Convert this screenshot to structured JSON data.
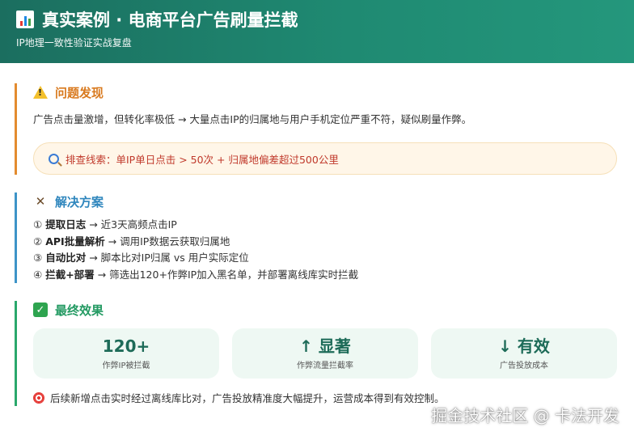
{
  "header": {
    "title": "真实案例 · 电商平台广告刷量拦截",
    "subtitle": "IP地理一致性验证实战复盘"
  },
  "problem": {
    "heading": "问题发现",
    "text": "广告点击量激增，但转化率极低 → 大量点击IP的归属地与用户手机定位严重不符，疑似刷量作弊。",
    "clue": "排查线索：单IP单日点击 > 50次 + 归属地偏差超过500公里"
  },
  "solution": {
    "heading": "解决方案",
    "steps": [
      {
        "num": "①",
        "bold": "提取日志",
        "text": " → 近3天高频点击IP"
      },
      {
        "num": "②",
        "bold": "API批量解析",
        "text": " → 调用IP数据云获取归属地"
      },
      {
        "num": "③",
        "bold": "自动比对",
        "text": " → 脚本比对IP归属 vs 用户实际定位"
      },
      {
        "num": "④",
        "bold": "拦截+部署",
        "text": " → 筛选出120+作弊IP加入黑名单，并部署离线库实时拦截"
      }
    ]
  },
  "effect": {
    "heading": "最终效果",
    "cards": [
      {
        "value": "120+",
        "label": "作弊IP被拦截"
      },
      {
        "value": "↑ 显著",
        "label": "作弊流量拦截率"
      },
      {
        "value": "↓ 有效",
        "label": "广告投放成本"
      }
    ],
    "note": "后续新增点击实时经过离线库比对，广告投放精准度大幅提升，运营成本得到有效控制。"
  },
  "watermark": "掘金技术社区 @ 卡法开发",
  "colors": {
    "header_bg": "#1f8a72",
    "problem_accent": "#e38b2f",
    "solution_accent": "#3d94c8",
    "effect_accent": "#2aa86b",
    "clue_text": "#c0392b"
  },
  "icons": {
    "header": "bar-chart-icon",
    "problem": "warning-icon",
    "clue": "magnifier-icon",
    "solution": "tools-icon",
    "effect": "check-icon",
    "note": "target-icon"
  }
}
